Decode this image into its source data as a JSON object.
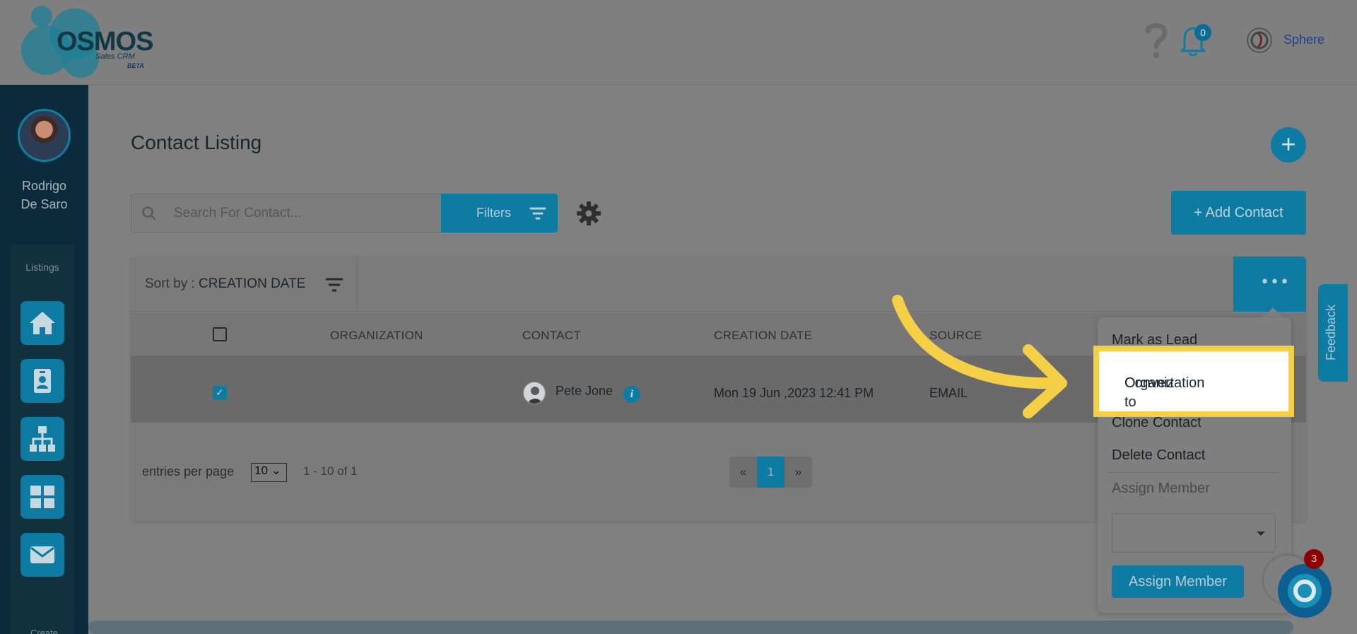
{
  "header": {
    "logo_text": "OSMOS",
    "logo_sub": "Sales CRM",
    "logo_badge": "BETA",
    "notifications_count": "0",
    "user_label": "Sphere"
  },
  "sidebar": {
    "user_name_line1": "Rodrigo",
    "user_name_line2": "De Saro",
    "section_label": "Listings",
    "items": [
      {
        "icon": "home-icon"
      },
      {
        "icon": "contact-card-icon"
      },
      {
        "icon": "sitemap-icon"
      },
      {
        "icon": "grid-icon"
      },
      {
        "icon": "envelope-icon"
      }
    ],
    "create_label": "Create"
  },
  "main": {
    "title": "Contact Listing",
    "search_placeholder": "Search For Contact...",
    "filters_label": "Filters",
    "add_contact_label": "+ Add Contact",
    "sort_prefix": "Sort by : ",
    "sort_value": "CREATION DATE",
    "more_label": "•••"
  },
  "table": {
    "columns": [
      "ORGANIZATION",
      "CONTACT",
      "CREATION DATE",
      "SOURCE"
    ],
    "rows": [
      {
        "checked": true,
        "organization": "",
        "contact": "Pete Jone",
        "creation_date": "Mon 19 Jun ,2023 12:41 PM",
        "source": "EMAIL"
      }
    ]
  },
  "pagination": {
    "entries_label": "entries per page",
    "page_size": "10",
    "range": "1 - 10 of 1",
    "prev": "«",
    "current": "1",
    "next": "»"
  },
  "dropdown": {
    "items": [
      "Mark as Lead",
      "Convert to Organization",
      "Clone Contact",
      "Delete Contact"
    ],
    "convert_line1": "Convert to",
    "convert_line2": "Organization",
    "assign_label": "Assign Member",
    "assign_button": "Assign Member"
  },
  "feedback_label": "Feedback",
  "chat_badge": "3",
  "colors": {
    "accent": "#0e7ba2",
    "highlight": "#f5cf45",
    "sidebar_bg": "#0b2a3b"
  }
}
